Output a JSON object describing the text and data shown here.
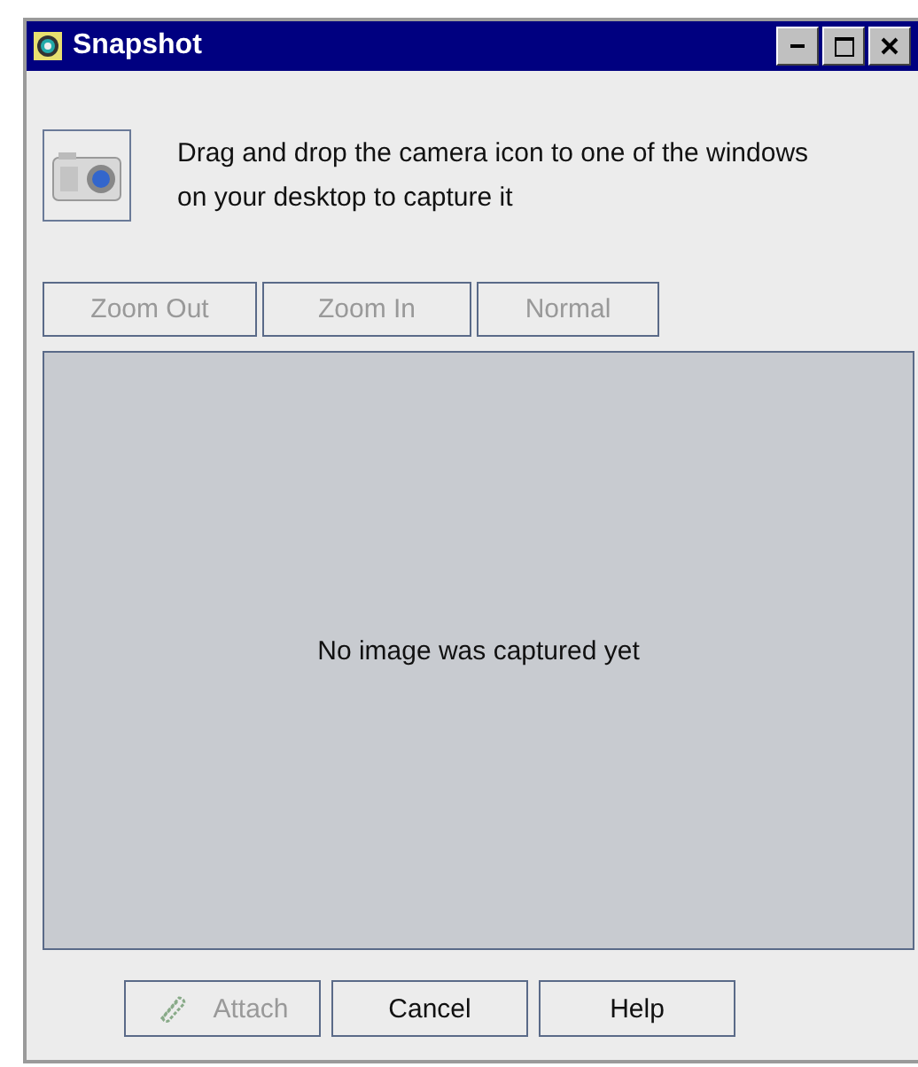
{
  "window": {
    "title": "Snapshot"
  },
  "instructions": "Drag and drop the camera icon to one of the windows on your desktop to capture it",
  "zoom_buttons": [
    {
      "label": "Zoom Out",
      "disabled": true
    },
    {
      "label": "Zoom In",
      "disabled": true
    },
    {
      "label": "Normal",
      "disabled": true
    }
  ],
  "preview": {
    "message": "No image was captured yet"
  },
  "buttons": [
    {
      "label": "Attach",
      "kind": "attach",
      "disabled": true
    },
    {
      "label": "Cancel",
      "kind": "plain",
      "disabled": false
    },
    {
      "label": "Help",
      "kind": "plain",
      "disabled": false
    }
  ]
}
